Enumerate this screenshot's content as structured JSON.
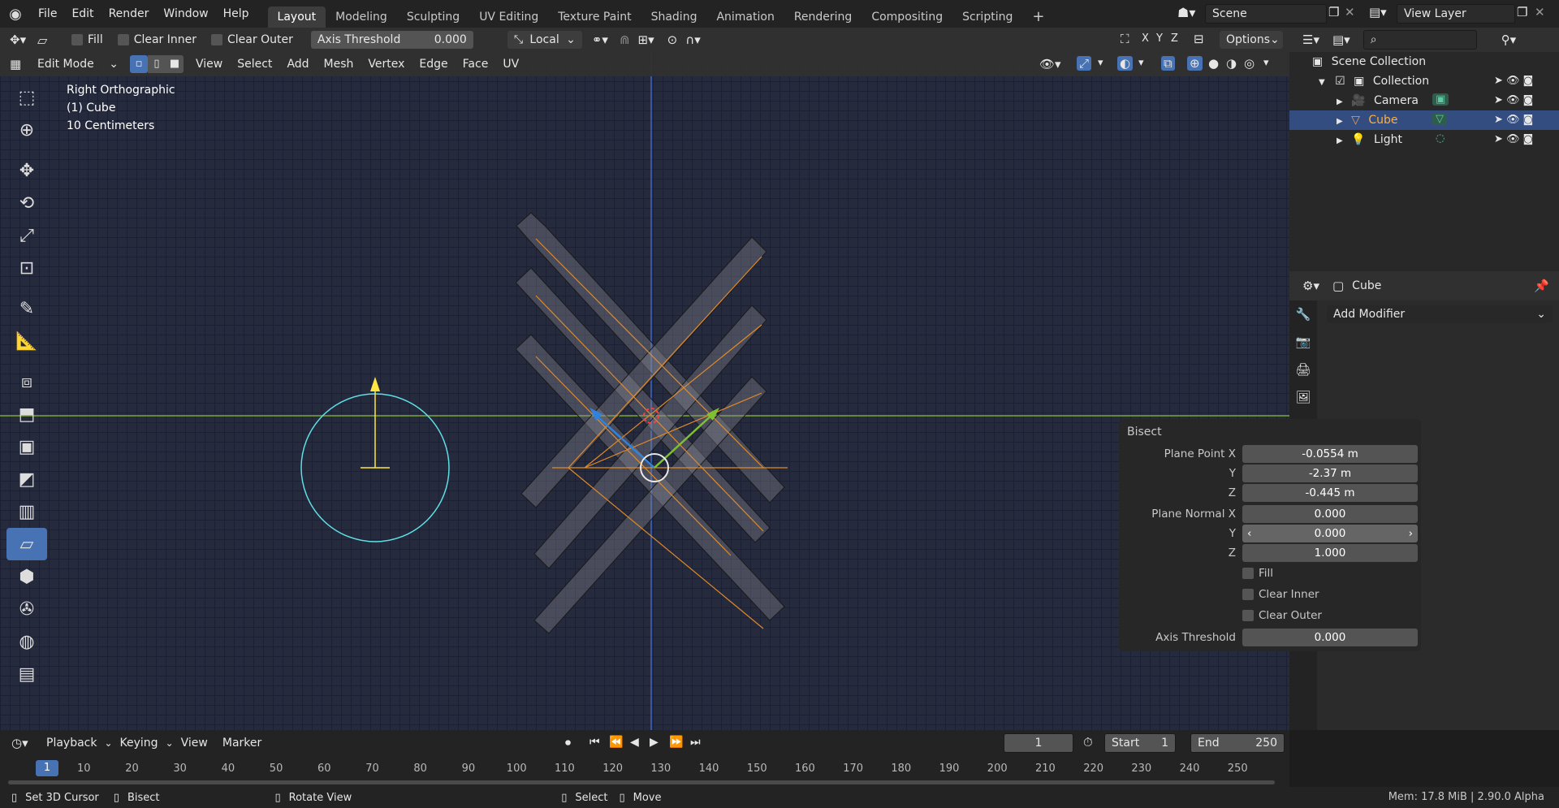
{
  "topbar": {
    "menus": [
      "File",
      "Edit",
      "Render",
      "Window",
      "Help"
    ],
    "workspaces": [
      "Layout",
      "Modeling",
      "Sculpting",
      "UV Editing",
      "Texture Paint",
      "Shading",
      "Animation",
      "Rendering",
      "Compositing",
      "Scripting"
    ],
    "active_workspace": "Layout",
    "scene": "Scene",
    "view_layer": "View Layer"
  },
  "toolsettings": {
    "fill": "Fill",
    "clear_inner": "Clear Inner",
    "clear_outer": "Clear Outer",
    "axis_threshold_label": "Axis Threshold",
    "axis_threshold_value": "0.000",
    "orientation": "Local",
    "axes": [
      "X",
      "Y",
      "Z"
    ],
    "options": "Options"
  },
  "viewport_header": {
    "mode": "Edit Mode",
    "menus": [
      "View",
      "Select",
      "Add",
      "Mesh",
      "Vertex",
      "Edge",
      "Face",
      "UV"
    ]
  },
  "viewport_overlay": {
    "view_name": "Right Orthographic",
    "object": "(1) Cube",
    "scale": "10 Centimeters"
  },
  "outliner": {
    "root": "Scene Collection",
    "collection": "Collection",
    "items": [
      "Camera",
      "Cube",
      "Light"
    ],
    "selected": "Cube"
  },
  "properties": {
    "object_name": "Cube",
    "add_modifier": "Add Modifier"
  },
  "bisect": {
    "title": "Bisect",
    "plane_point_x_label": "Plane Point X",
    "plane_point_x": "-0.0554 m",
    "y_label": "Y",
    "plane_point_y": "-2.37 m",
    "z_label": "Z",
    "plane_point_z": "-0.445 m",
    "plane_normal_x_label": "Plane Normal X",
    "plane_normal_x": "0.000",
    "plane_normal_y": "0.000",
    "plane_normal_z": "1.000",
    "fill": "Fill",
    "clear_inner": "Clear Inner",
    "clear_outer": "Clear Outer",
    "axis_threshold_label": "Axis Threshold",
    "axis_threshold": "0.000"
  },
  "timeline": {
    "menus": [
      "Playback",
      "Keying",
      "View",
      "Marker"
    ],
    "current_frame": "1",
    "start_label": "Start",
    "start": "1",
    "end_label": "End",
    "end": "250",
    "ticks": [
      "10",
      "20",
      "30",
      "40",
      "50",
      "60",
      "70",
      "80",
      "90",
      "100",
      "110",
      "120",
      "130",
      "140",
      "150",
      "160",
      "170",
      "180",
      "190",
      "200",
      "210",
      "220",
      "230",
      "240",
      "250"
    ]
  },
  "statusbar": {
    "set_cursor": "Set 3D Cursor",
    "bisect": "Bisect",
    "rotate": "Rotate View",
    "select": "Select",
    "move": "Move",
    "memory": "Mem: 17.8 MiB | 2.90.0 Alpha"
  }
}
